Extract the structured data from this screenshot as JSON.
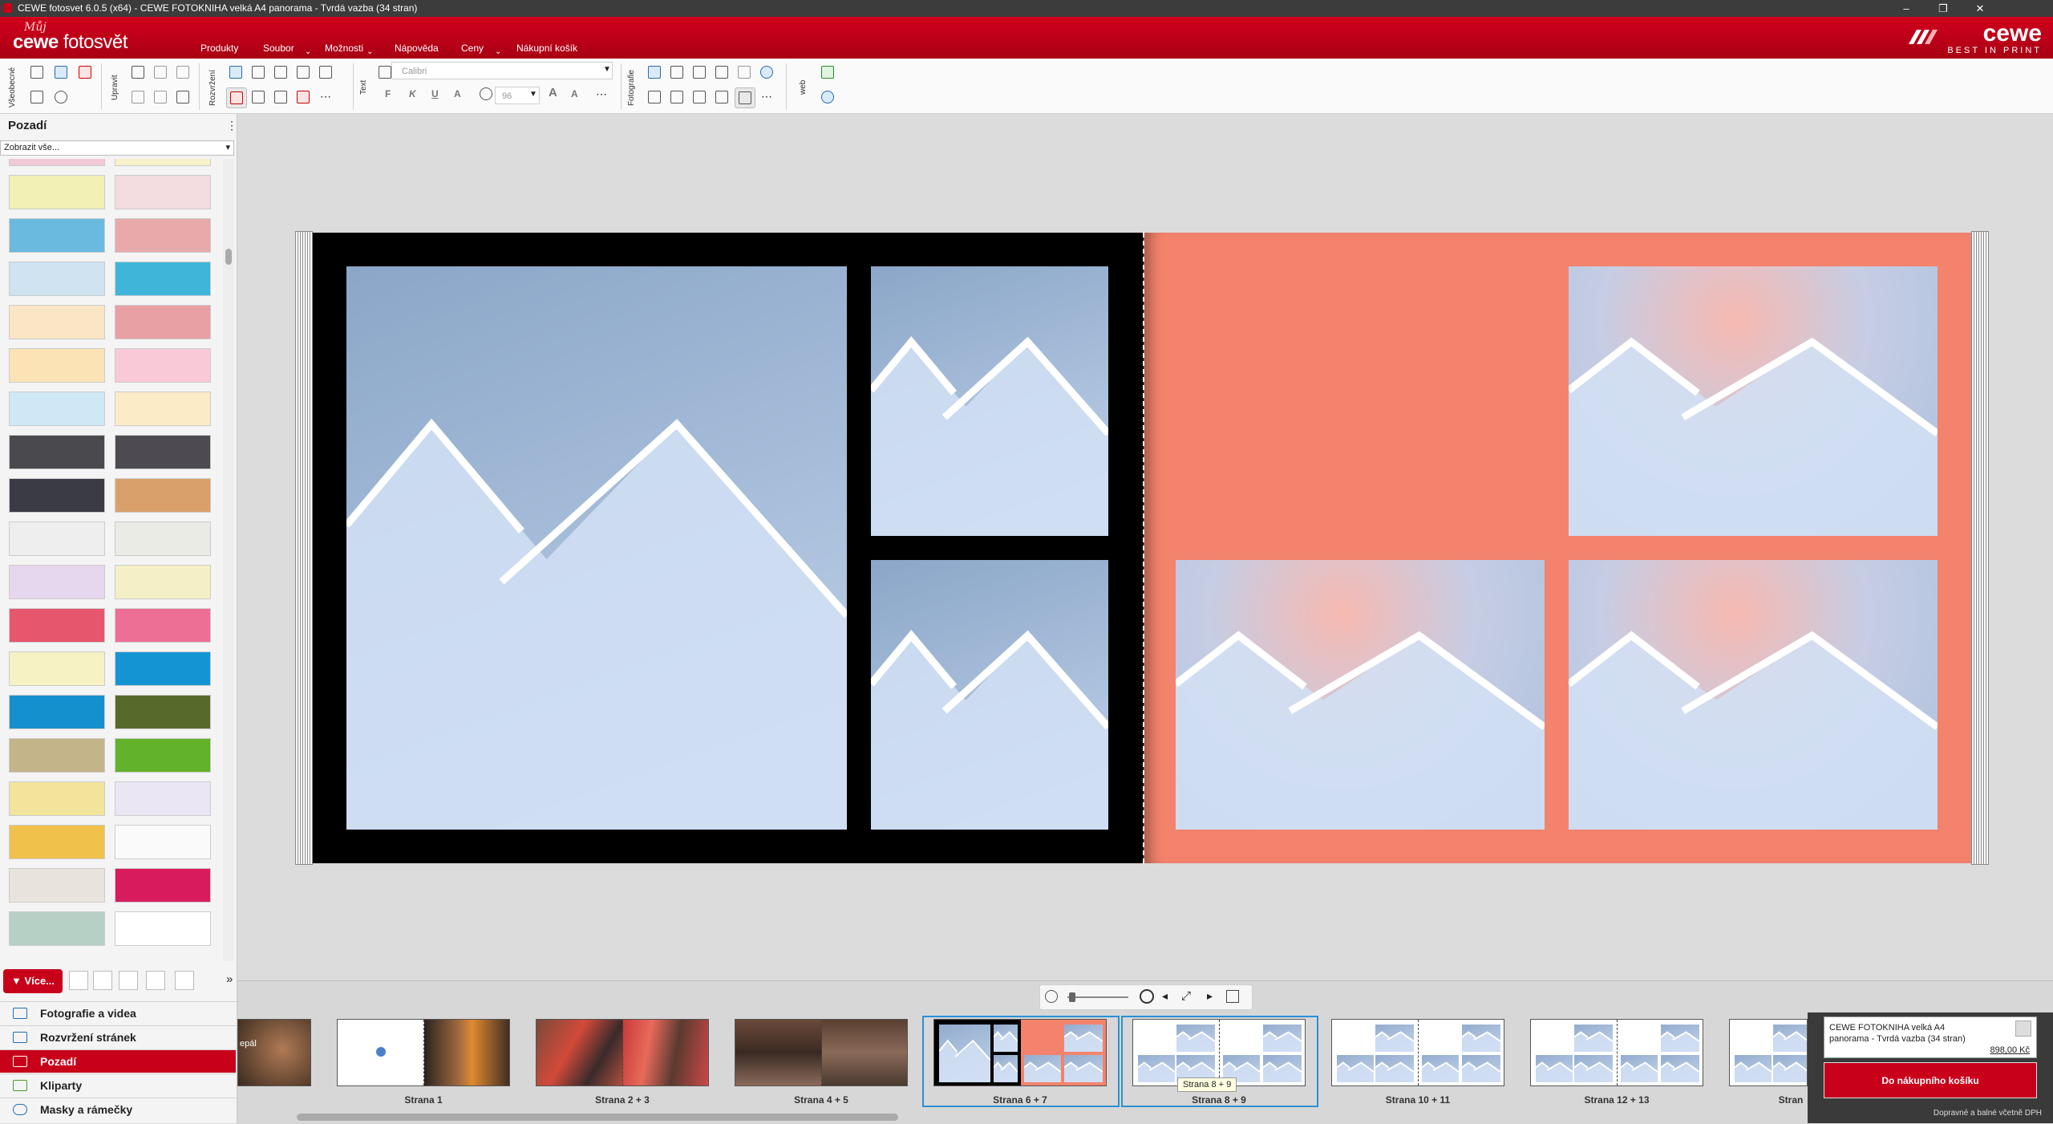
{
  "window": {
    "title": "CEWE fotosvet 6.0.5 (x64) - CEWE FOTOKNIHA velká A4 panorama - Tvrdá vazba  (34 stran)",
    "controls": [
      "–",
      "❐",
      "✕"
    ]
  },
  "brand": {
    "logo_top": "Můj",
    "logo_main": "cewe",
    "logo_sub": "fotosvět",
    "right_name": "cewe",
    "right_tagline": "BEST IN PRINT"
  },
  "menu": [
    "Produkty",
    "Soubor",
    "Možnosti",
    "Nápověda",
    "Ceny",
    "Nákupní košík"
  ],
  "toolbar": {
    "groups": [
      "Všeobecné",
      "Upravit",
      "Rozvržení",
      "Text",
      "Fotografie",
      "web"
    ],
    "font_name": "Calibri",
    "font_size": "96",
    "format_buttons": [
      "F",
      "K",
      "U",
      "A",
      "A",
      "A"
    ]
  },
  "left_panel": {
    "title": "Pozadí",
    "filter": "Zobrazit vše...",
    "more_button": "Více...",
    "collapse": "»",
    "nav": [
      {
        "label": "Fotografie a videa",
        "active": false
      },
      {
        "label": "Rozvržení stránek",
        "active": false
      },
      {
        "label": "Pozadí",
        "active": true
      },
      {
        "label": "Kliparty",
        "active": false
      },
      {
        "label": "Masky a rámečky",
        "active": false
      }
    ],
    "swatches": [
      [
        "#f2c9d6",
        "#f7f1cc"
      ],
      [
        "#f3f0b5",
        "#f4dde0"
      ],
      [
        "#6ab9de",
        "#e8a9aa"
      ],
      [
        "#cfe3f1",
        "#3fb6d9"
      ],
      [
        "#fae6c4",
        "#e8a0a4"
      ],
      [
        "#fbe3b6",
        "#f9c9d7"
      ],
      [
        "#cfe8f5",
        "#fcebc7"
      ],
      [
        "#4a4a4e",
        "#4d4a52"
      ],
      [
        "#3b3b45",
        "#d9a06b"
      ],
      [
        "#eeeeee",
        "#e9ebe4"
      ],
      [
        "#e6d6ee",
        "#f5efc7"
      ],
      [
        "#e6566d",
        "#ee6f95"
      ],
      [
        "#f6f2c4",
        "#1594d4"
      ],
      [
        "#1590cf",
        "#576a2c"
      ],
      [
        "#c4b489",
        "#63b22b"
      ],
      [
        "#f2e49a",
        "#eae6f3"
      ],
      [
        "#f0c14b",
        "#fafafa"
      ],
      [
        "#e8e3dc",
        "#d81b5d"
      ],
      [
        "#b7d0c6",
        "#ffffff"
      ]
    ]
  },
  "filmstrip": {
    "pages": [
      "Strana 1",
      "Strana 2 + 3",
      "Strana 4 + 5",
      "Strana 6 + 7",
      "Strana 8 + 9",
      "Strana 10 + 11",
      "Strana 12 + 13"
    ],
    "partial_label": "epál",
    "cut_label": "Stran",
    "tooltip": "Strana 8 + 9"
  },
  "cart": {
    "product": "CEWE FOTOKNIHA velká A4 panorama - Tvrdá vazba  (34 stran)",
    "price": "898,00 Kč",
    "button": "Do nákupního košíku",
    "note": "Dopravné a balné včetně DPH"
  }
}
